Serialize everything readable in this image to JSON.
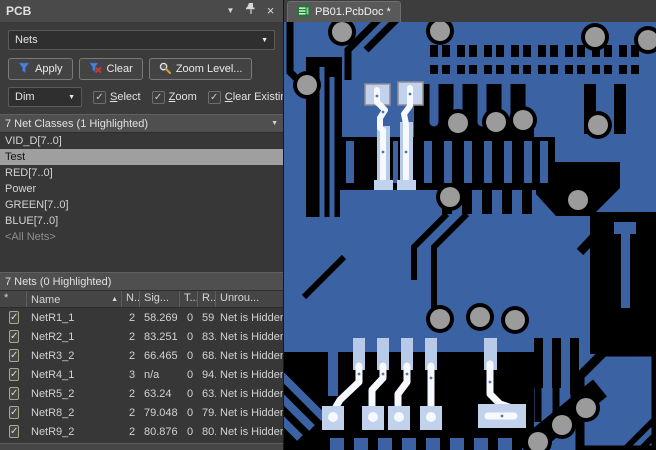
{
  "panel": {
    "title": "PCB",
    "filter_mode": "Nets",
    "apply_label": "Apply",
    "clear_label": "Clear",
    "zoom_level_label": "Zoom Level...",
    "dim_mode": "Dim",
    "options": [
      {
        "label": "Select",
        "checked": true
      },
      {
        "label": "Zoom",
        "checked": true
      },
      {
        "label": "Clear Existing",
        "checked": true
      }
    ],
    "net_classes": {
      "header": "7 Net Classes (1 Highlighted)",
      "items": [
        "VID_D[7..0]",
        "Test",
        "RED[7..0]",
        "Power",
        "GREEN[7..0]",
        "BLUE[7..0]",
        "<All Nets>"
      ],
      "selected_item": "Test"
    },
    "nets": {
      "header": "7 Nets (0 Highlighted)",
      "columns": {
        "check": "*",
        "name": "Name",
        "nodes": "N..",
        "signal": "Sig...",
        "t": "T...",
        "routed": "R...",
        "unrouted": "Unrou..."
      },
      "rows": [
        {
          "checked": true,
          "name": "NetR1_1",
          "nodes": "2",
          "signal": "58.269",
          "t": "0",
          "routed": "59",
          "unrouted": "Net is Hidden"
        },
        {
          "checked": true,
          "name": "NetR2_1",
          "nodes": "2",
          "signal": "83.251",
          "t": "0",
          "routed": "83.",
          "unrouted": "Net is Hidden"
        },
        {
          "checked": true,
          "name": "NetR3_2",
          "nodes": "2",
          "signal": "66.465",
          "t": "0",
          "routed": "68.",
          "unrouted": "Net is Hidden"
        },
        {
          "checked": true,
          "name": "NetR4_1",
          "nodes": "3",
          "signal": "n/a",
          "t": "0",
          "routed": "94.",
          "unrouted": "Net is Hidden"
        },
        {
          "checked": true,
          "name": "NetR5_2",
          "nodes": "2",
          "signal": "63.24",
          "t": "0",
          "routed": "63.",
          "unrouted": "Net is Hidden"
        },
        {
          "checked": true,
          "name": "NetR8_2",
          "nodes": "2",
          "signal": "79.048",
          "t": "0",
          "routed": "79.",
          "unrouted": "Net is Hidden"
        },
        {
          "checked": true,
          "name": "NetR9_2",
          "nodes": "2",
          "signal": "80.876",
          "t": "0",
          "routed": "80.",
          "unrouted": "Net is Hidden"
        }
      ]
    }
  },
  "editor": {
    "tab_label": "PB01.PcbDoc *"
  },
  "icons": {
    "collapse": "▼",
    "close": "×",
    "dropdown_arrow": "▼",
    "sort_asc": "▲",
    "check": "✓",
    "asterisk": "*"
  },
  "colors": {
    "panel_bg": "#3b3b3b",
    "selected_row_bg": "#9f9f9f",
    "pcb_copper_blue": "#3b62a3",
    "pcb_highlight": "#c3d2ec",
    "pcb_highlight_bright": "#f6f9ff",
    "pcb_via_gray": "#9b9b9b",
    "pcb_background": "#000000",
    "apply_funnel_blue": "#4d7fd6",
    "clear_x_red": "#d03b2f",
    "magnifier_handle_yellow": "#d79b3a",
    "doc_icon_green": "#1f7a33"
  }
}
